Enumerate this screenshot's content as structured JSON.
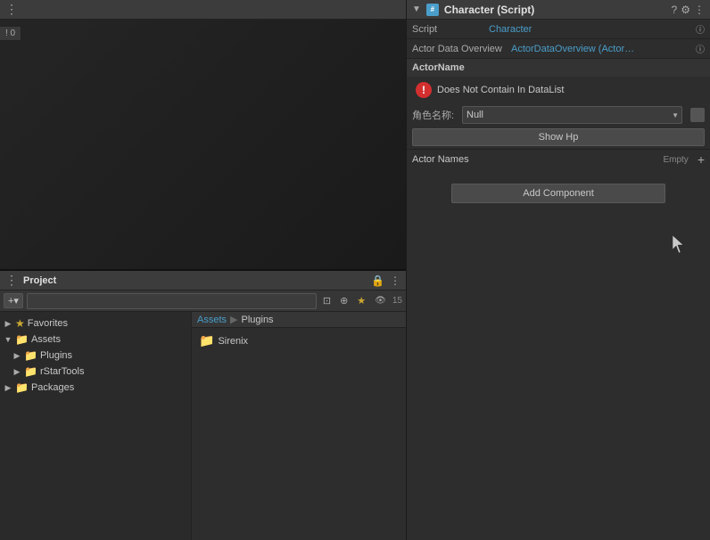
{
  "inspector": {
    "header": {
      "arrow": "▼",
      "icon_label": "#",
      "title": "Character (Script)",
      "help_icon": "?",
      "settings_icon": "⚙",
      "more_icon": "⋮"
    },
    "script_row": {
      "label": "Script",
      "value": "Character",
      "info_icon": "ⓘ"
    },
    "actor_data_row": {
      "label": "Actor Data Overview",
      "value": "ActorDataOverview (Actor D̶a̶",
      "info_icon": "ⓘ"
    },
    "actor_name_section": {
      "label": "ActorName"
    },
    "error": {
      "message": "Does Not Contain In DataList"
    },
    "role_row": {
      "label": "角色名称:",
      "value": "Null"
    },
    "show_hp_btn": "Show Hp",
    "actor_names": {
      "label": "Actor Names",
      "empty": "Empty"
    },
    "add_component_btn": "Add Component"
  },
  "project": {
    "title": "Project",
    "toolbar": {
      "add_label": "+▾",
      "search_placeholder": "",
      "count": "15",
      "icon1": "⊡",
      "icon2": "⊕",
      "icon3": "★"
    },
    "breadcrumb": {
      "root": "Assets",
      "current": "Plugins"
    },
    "tree": [
      {
        "id": "favorites",
        "label": "Favorites",
        "indent": 0,
        "arrow": "▶",
        "icon": "★",
        "icon_color": "#cca833"
      },
      {
        "id": "assets",
        "label": "Assets",
        "indent": 0,
        "arrow": "▼",
        "icon": "📁",
        "expanded": true
      },
      {
        "id": "plugins",
        "label": "Plugins",
        "indent": 1,
        "arrow": "▶",
        "icon": "📁"
      },
      {
        "id": "rstartools",
        "label": "rStarTools",
        "indent": 1,
        "arrow": "▶",
        "icon": "📁"
      },
      {
        "id": "packages",
        "label": "Packages",
        "indent": 0,
        "arrow": "▶",
        "icon": "📁"
      }
    ],
    "files": [
      {
        "name": "Sirenix",
        "icon": "📁"
      }
    ]
  }
}
